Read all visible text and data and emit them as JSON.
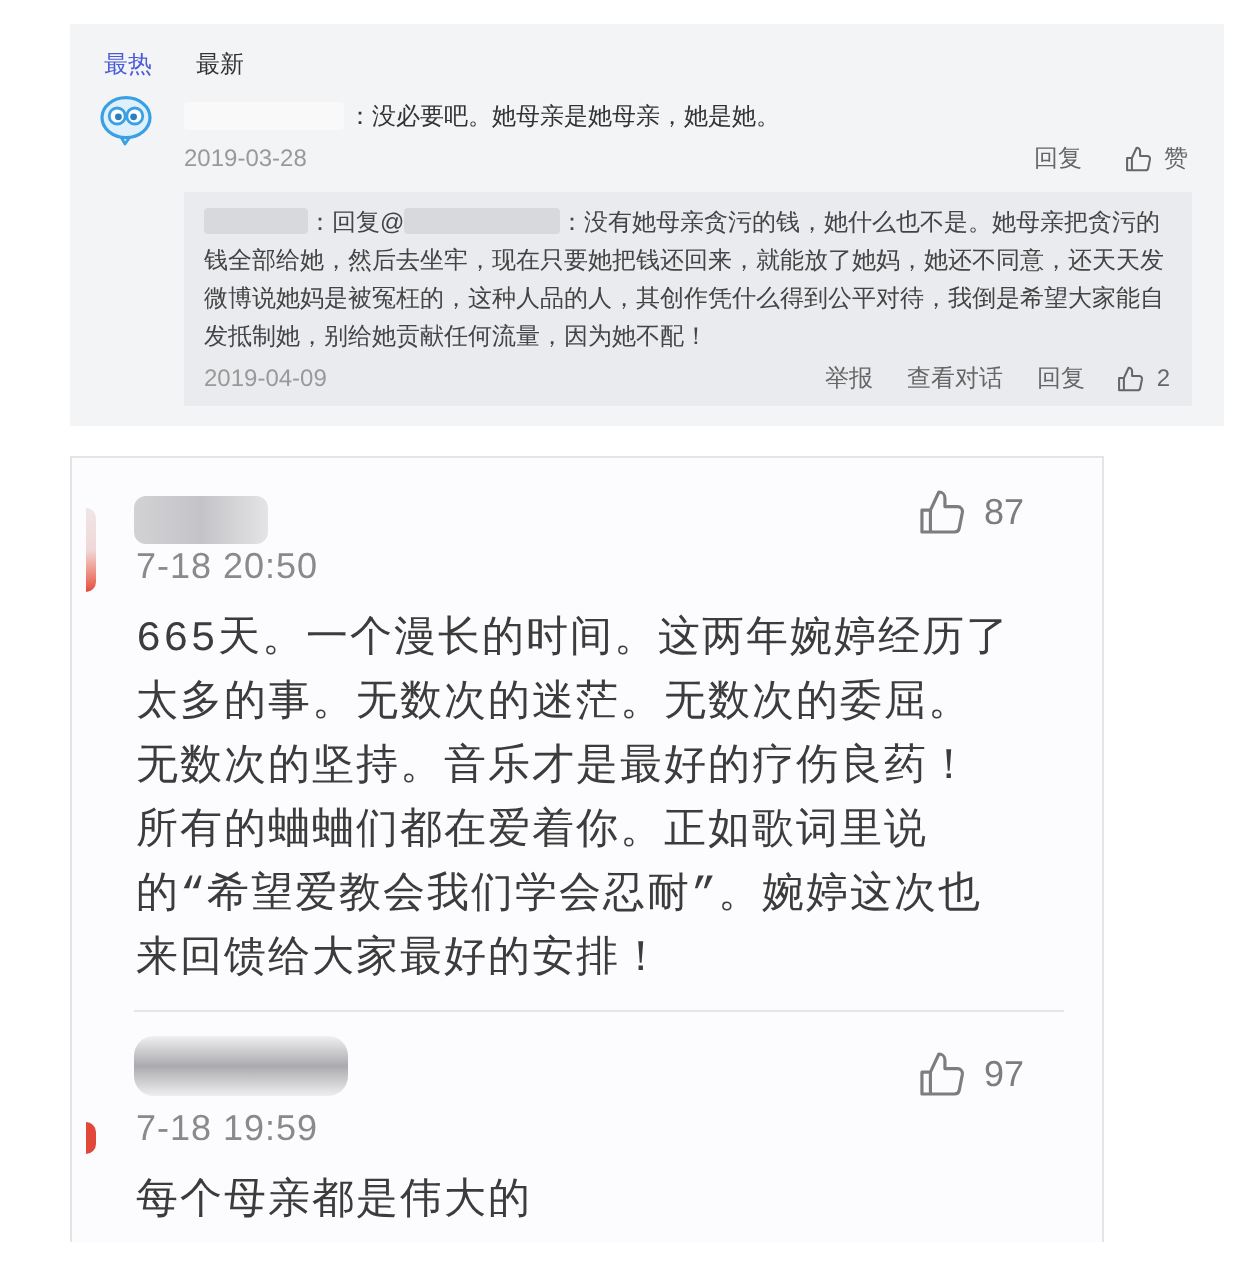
{
  "comment_section": {
    "tabs": [
      {
        "label": "最热",
        "selected": true
      },
      {
        "label": "最新",
        "selected": false
      }
    ],
    "comment": {
      "text": "：没必要吧。她母亲是她母亲，她是她。",
      "date": "2019-03-28",
      "actions": [
        {
          "kind": "text",
          "label": "回复"
        },
        {
          "kind": "like",
          "label": "赞"
        }
      ],
      "reply": {
        "mention_prefix": "：回复@",
        "text": "：没有她母亲贪污的钱，她什么也不是。她母亲把贪污的钱全部给她，然后去坐牢，现在只要她把钱还回来，就能放了她妈，她还不同意，还天天发微博说她妈是被冤枉的，这种人品的人，其创作凭什么得到公平对待，我倒是希望大家能自发抵制她，别给她贡献任何流量，因为她不配！",
        "date": "2019-04-09",
        "actions": [
          {
            "kind": "text",
            "label": "举报"
          },
          {
            "kind": "text",
            "label": "查看对话"
          },
          {
            "kind": "text",
            "label": "回复"
          },
          {
            "kind": "like",
            "label": "2"
          }
        ]
      }
    }
  },
  "mobile_comments": [
    {
      "date": "7-18 20:50",
      "likes": "87",
      "text": "665天。一个漫长的时间。这两年婉婷经历了太多的事。无数次的迷茫。无数次的委屈。无数次的坚持。音乐才是最好的疗伤良药！所有的蛐蛐们都在爱着你。正如歌词里说的“希望爱教会我们学会忍耐”。婉婷这次也来回馈给大家最好的安排！"
    },
    {
      "date": "7-18 19:59",
      "likes": "97",
      "text": "每个母亲都是伟大的"
    }
  ]
}
